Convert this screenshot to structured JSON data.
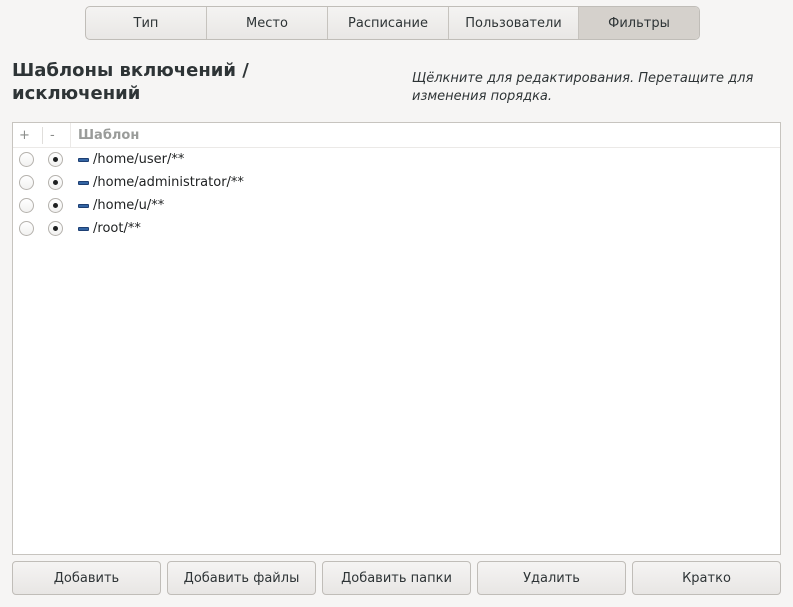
{
  "tabs": [
    {
      "label": "Тип"
    },
    {
      "label": "Место"
    },
    {
      "label": "Расписание"
    },
    {
      "label": "Пользователи"
    },
    {
      "label": "Фильтры",
      "active": true
    }
  ],
  "heading": "Шаблоны включений / исключений",
  "hint": "Щёлкните для редактирования. Перетащите для изменения порядка.",
  "list": {
    "headers": {
      "plus": "+",
      "minus": "-",
      "pattern": "Шаблон"
    },
    "rows": [
      {
        "pattern": "/home/user/**",
        "include": false,
        "exclude": true,
        "icon": "minus-icon"
      },
      {
        "pattern": "/home/administrator/**",
        "include": false,
        "exclude": true,
        "icon": "minus-icon"
      },
      {
        "pattern": "/home/u/**",
        "include": false,
        "exclude": true,
        "icon": "minus-icon"
      },
      {
        "pattern": "/root/**",
        "include": false,
        "exclude": true,
        "icon": "minus-icon"
      }
    ]
  },
  "buttons": {
    "add": "Добавить",
    "add_files": "Добавить файлы",
    "add_folders": "Добавить папки",
    "remove": "Удалить",
    "brief": "Кратко"
  },
  "colors": {
    "accent_icon": "#3465a4",
    "active_tab": "#d5d1cc"
  }
}
